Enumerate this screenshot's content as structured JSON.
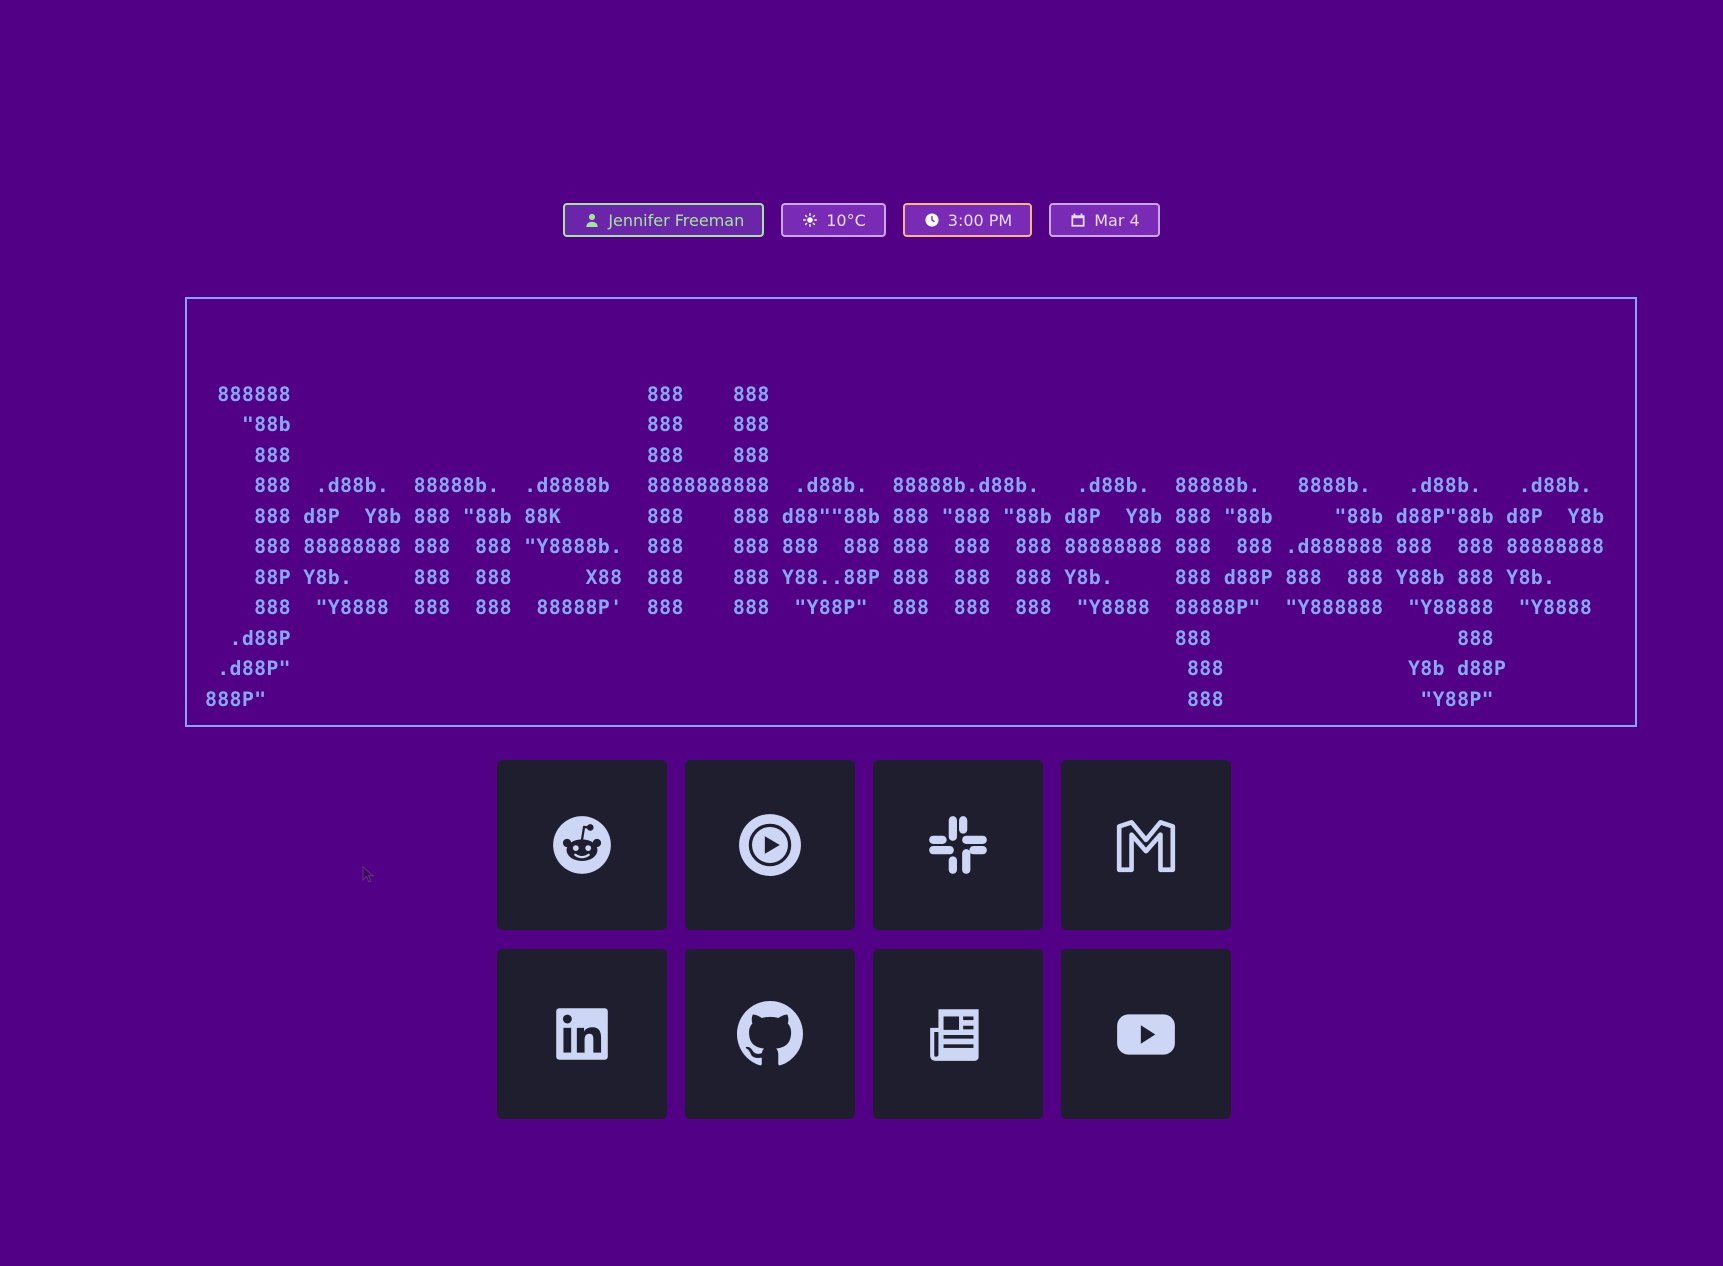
{
  "status": {
    "user": "Jennifer Freeman",
    "weather": "10°C",
    "time": "3:00 PM",
    "date": "Mar 4",
    "icons": [
      "user-icon",
      "sun-icon",
      "clock-icon",
      "calendar-icon"
    ]
  },
  "banner": {
    "lines": [
      "",
      " 888888                             888    888",
      "   \"88b                             888    888",
      "    888                             888    888",
      "    888  .d88b.  88888b.  .d8888b   8888888888  .d88b.  88888b.d88b.   .d88b.  88888b.   8888b.   .d88b.   .d88b.",
      "    888 d8P  Y8b 888 \"88b 88K       888    888 d88\"\"88b 888 \"888 \"88b d8P  Y8b 888 \"88b     \"88b d88P\"88b d8P  Y8b",
      "    888 88888888 888  888 \"Y8888b.  888    888 888  888 888  888  888 88888888 888  888 .d888888 888  888 88888888",
      "    88P Y8b.     888  888      X88  888    888 Y88..88P 888  888  888 Y8b.     888 d88P 888  888 Y88b 888 Y8b.",
      "    888  \"Y8888  888  888  88888P'  888    888  \"Y88P\"  888  888  888  \"Y8888  88888P\"  \"Y888888  \"Y88888  \"Y8888",
      "  .d88P                                                                        888                    888",
      " .d88P\"                                                                         888               Y8b d88P",
      "888P\"                                                                           888                \"Y88P\""
    ]
  },
  "links": [
    {
      "name": "reddit",
      "icon": "reddit-icon"
    },
    {
      "name": "youtube-music",
      "icon": "play-circle-icon"
    },
    {
      "name": "slack",
      "icon": "slack-icon"
    },
    {
      "name": "gmail",
      "icon": "gmail-icon"
    },
    {
      "name": "linkedin",
      "icon": "linkedin-icon"
    },
    {
      "name": "github",
      "icon": "github-icon"
    },
    {
      "name": "news",
      "icon": "newspaper-icon"
    },
    {
      "name": "youtube",
      "icon": "youtube-icon"
    }
  ],
  "colors": {
    "background": "#520085",
    "tile": "#1e1e2e",
    "icon": "#cdd6f4",
    "ascii": "#89a7f7",
    "user_accent": "#a6e3a1",
    "time_accent": "#fab387"
  }
}
